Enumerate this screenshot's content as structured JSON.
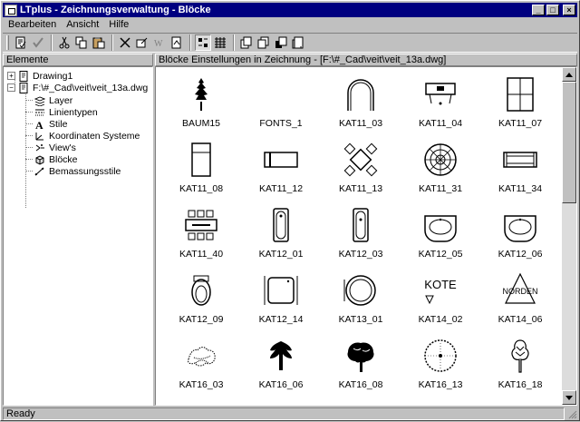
{
  "window": {
    "title": "LTplus - Zeichnungsverwaltung - Blöcke",
    "minimize": "_",
    "maximize": "□",
    "close": "×"
  },
  "menu": [
    {
      "label": "Bearbeiten"
    },
    {
      "label": "Ansicht"
    },
    {
      "label": "Hilfe"
    }
  ],
  "toolbar": {
    "tools": [
      "properties-icon",
      "check-icon",
      "cut-icon",
      "copy-icon",
      "paste-icon",
      "delete-icon",
      "edit-block-icon",
      "wblock-icon",
      "import-icon",
      "small-icons-icon",
      "large-icons-icon",
      "view1-icon",
      "view2-icon",
      "view3-icon",
      "view4-icon"
    ]
  },
  "left_pane": {
    "header": "Elemente",
    "tree": [
      {
        "label": "Drawing1",
        "icon": "drawing-icon",
        "expander": "+"
      },
      {
        "label": "F:\\#_Cad\\veit\\veit_13a.dwg",
        "icon": "drawing-icon",
        "expander": "−"
      },
      {
        "label": "Layer",
        "icon": "layer-icon"
      },
      {
        "label": "Linientypen",
        "icon": "linetype-icon"
      },
      {
        "label": "Stile",
        "icon": "text-style-icon"
      },
      {
        "label": "Koordinaten Systeme",
        "icon": "ucs-icon"
      },
      {
        "label": "View's",
        "icon": "view-icon"
      },
      {
        "label": "Blöcke",
        "icon": "block-icon"
      },
      {
        "label": "Bemassungsstile",
        "icon": "dimstyle-icon"
      }
    ]
  },
  "right_pane": {
    "header": "Blöcke Einstellungen in Zeichnung - [F:\\#_Cad\\veit\\veit_13a.dwg]",
    "blocks": [
      {
        "name": "BAUM15",
        "icon": "tree-icon"
      },
      {
        "name": "FONTS_1",
        "icon": "blank-icon"
      },
      {
        "name": "KAT11_03",
        "icon": "arch-icon"
      },
      {
        "name": "KAT11_04",
        "icon": "desk-icon"
      },
      {
        "name": "KAT11_07",
        "icon": "wardrobe-icon"
      },
      {
        "name": "KAT11_08",
        "icon": "cabinet-icon"
      },
      {
        "name": "KAT11_12",
        "icon": "sofa-icon"
      },
      {
        "name": "KAT11_13",
        "icon": "table-chairs-icon"
      },
      {
        "name": "KAT11_31",
        "icon": "round-rug-icon"
      },
      {
        "name": "KAT11_34",
        "icon": "bench-icon"
      },
      {
        "name": "KAT11_40",
        "icon": "conference-table-icon"
      },
      {
        "name": "KAT12_01",
        "icon": "bathtub-icon"
      },
      {
        "name": "KAT12_03",
        "icon": "bathtub-icon"
      },
      {
        "name": "KAT12_05",
        "icon": "sink-icon"
      },
      {
        "name": "KAT12_06",
        "icon": "sink-icon"
      },
      {
        "name": "KAT12_09",
        "icon": "toilet-icon"
      },
      {
        "name": "KAT12_14",
        "icon": "shower-icon"
      },
      {
        "name": "KAT13_01",
        "icon": "round-sink-icon"
      },
      {
        "name": "KAT14_02",
        "icon": "kote-icon",
        "text": "KOTE"
      },
      {
        "name": "KAT14_06",
        "icon": "norden-icon",
        "text": "NORDEN"
      },
      {
        "name": "KAT16_03",
        "icon": "bush-icon"
      },
      {
        "name": "KAT16_06",
        "icon": "tree-icon"
      },
      {
        "name": "KAT16_08",
        "icon": "tree-crown-icon"
      },
      {
        "name": "KAT16_13",
        "icon": "round-tree-icon"
      },
      {
        "name": "KAT16_18",
        "icon": "tree-icon"
      }
    ]
  },
  "status": {
    "text": "Ready"
  }
}
